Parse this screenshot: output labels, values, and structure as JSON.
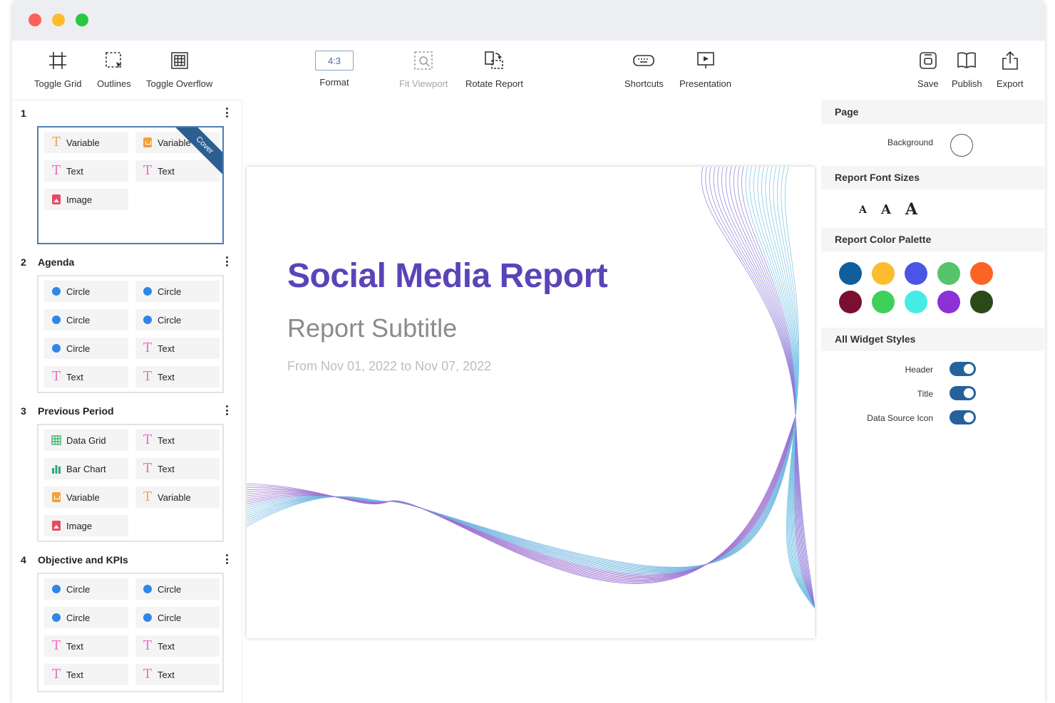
{
  "toolbar": {
    "toggle_grid": "Toggle Grid",
    "outlines": "Outlines",
    "toggle_overflow": "Toggle Overflow",
    "format_value": "4:3",
    "format": "Format",
    "fit_viewport": "Fit Viewport",
    "rotate_report": "Rotate Report",
    "shortcuts": "Shortcuts",
    "presentation": "Presentation",
    "save": "Save",
    "publish": "Publish",
    "export": "Export"
  },
  "sidebar": {
    "sections": [
      {
        "num": "1",
        "title": "",
        "ribbon": "Cover",
        "items": [
          {
            "icon": "text-orange",
            "label": "Variable"
          },
          {
            "icon": "variable",
            "label": "Variable"
          },
          {
            "icon": "text",
            "label": "Text"
          },
          {
            "icon": "text",
            "label": "Text"
          },
          {
            "icon": "image",
            "label": "Image"
          }
        ]
      },
      {
        "num": "2",
        "title": "Agenda",
        "items": [
          {
            "icon": "circle",
            "label": "Circle"
          },
          {
            "icon": "circle",
            "label": "Circle"
          },
          {
            "icon": "circle",
            "label": "Circle"
          },
          {
            "icon": "circle",
            "label": "Circle"
          },
          {
            "icon": "circle",
            "label": "Circle"
          },
          {
            "icon": "text",
            "label": "Text"
          },
          {
            "icon": "text",
            "label": "Text"
          },
          {
            "icon": "text",
            "label": "Text"
          }
        ]
      },
      {
        "num": "3",
        "title": "Previous Period",
        "items": [
          {
            "icon": "data-grid",
            "label": "Data Grid"
          },
          {
            "icon": "text",
            "label": "Text"
          },
          {
            "icon": "bar-chart",
            "label": "Bar Chart"
          },
          {
            "icon": "text",
            "label": "Text"
          },
          {
            "icon": "variable",
            "label": "Variable"
          },
          {
            "icon": "text-orange",
            "label": "Variable"
          },
          {
            "icon": "image",
            "label": "Image"
          }
        ]
      },
      {
        "num": "4",
        "title": "Objective and KPIs",
        "items": [
          {
            "icon": "circle",
            "label": "Circle"
          },
          {
            "icon": "circle",
            "label": "Circle"
          },
          {
            "icon": "circle",
            "label": "Circle"
          },
          {
            "icon": "circle",
            "label": "Circle"
          },
          {
            "icon": "text",
            "label": "Text"
          },
          {
            "icon": "text",
            "label": "Text"
          },
          {
            "icon": "text",
            "label": "Text"
          },
          {
            "icon": "text",
            "label": "Text"
          }
        ]
      }
    ]
  },
  "slide": {
    "title": "Social Media Report",
    "subtitle": "Report Subtitle",
    "date_range": "From Nov 01, 2022 to Nov 07, 2022"
  },
  "panel": {
    "page_header": "Page",
    "background_label": "Background",
    "font_sizes_header": "Report Font Sizes",
    "font_letter": "A",
    "palette_header": "Report Color Palette",
    "palette": [
      "#0f5f9e",
      "#fbbd2e",
      "#4a55e6",
      "#55c46a",
      "#fb6422",
      "#7a0f30",
      "#3fd05a",
      "#45ece6",
      "#8b31d6",
      "#2b4a17"
    ],
    "widget_styles_header": "All Widget Styles",
    "toggles": [
      {
        "label": "Header",
        "on": true
      },
      {
        "label": "Title",
        "on": true
      },
      {
        "label": "Data Source Icon",
        "on": true
      }
    ]
  },
  "colors": {
    "accent": "#27619b",
    "title": "#5a44b8",
    "selection": "#4f7cb8"
  }
}
